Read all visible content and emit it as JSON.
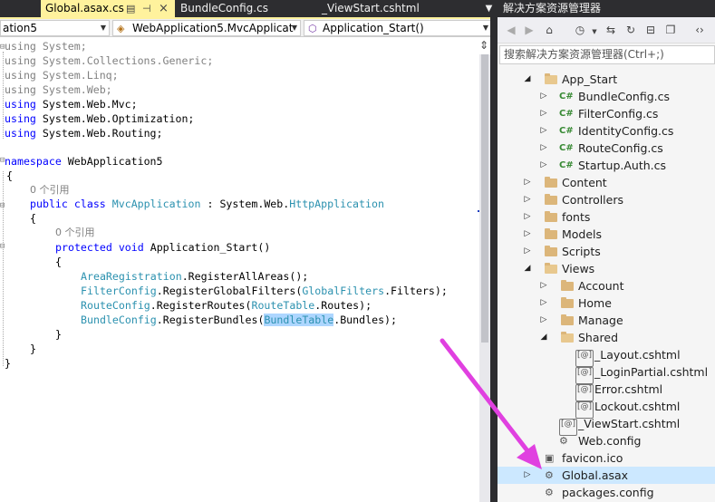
{
  "tabs": {
    "active": {
      "label": "Global.asax.cs",
      "pin_icon": "pin-icon",
      "close_icon": "close-icon"
    },
    "second": {
      "label": "BundleConfig.cs"
    },
    "third": {
      "label": "_ViewStart.cshtml"
    }
  },
  "nav": {
    "project": "ation5",
    "class": "WebApplication5.MvcApplicat",
    "member": "Application_Start()"
  },
  "code": {
    "using1": "using System;",
    "using2": "using System.Collections.Generic;",
    "using3": "using System.Linq;",
    "using4": "using System.Web;",
    "using5_kw": "using",
    "using5_ns": " System.Web.Mvc;",
    "using6_kw": "using",
    "using6_ns": " System.Web.Optimization;",
    "using7_kw": "using",
    "using7_ns": " System.Web.Routing;",
    "ns_kw": "namespace",
    "ns_name": " WebApplication5",
    "brace_open": "{",
    "brace_close": "}",
    "ref_class": "0 个引用",
    "class_kw1": "public",
    "class_kw2": "class",
    "class_name": "MvcApplication",
    "class_colon": " : ",
    "class_base_ns": "System.Web.",
    "class_base": "HttpApplication",
    "ref_method": "0 个引用",
    "method_kw1": "protected",
    "method_kw2": "void",
    "method_name": " Application_Start()",
    "l1_type": "AreaRegistration",
    "l1_rest": ".RegisterAllAreas();",
    "l2_type": "FilterConfig",
    "l2_mid": ".RegisterGlobalFilters(",
    "l2_type2": "GlobalFilters",
    "l2_rest": ".Filters);",
    "l3_type": "RouteConfig",
    "l3_mid": ".RegisterRoutes(",
    "l3_type2": "RouteTable",
    "l3_rest": ".Routes);",
    "l4_type": "BundleConfig",
    "l4_mid": ".RegisterBundles(",
    "l4_type2": "BundleTable",
    "l4_rest": ".Bundles);"
  },
  "explorer": {
    "title": "解决方案资源管理器",
    "search_placeholder": "搜索解决方案资源管理器(Ctrl+;)",
    "tree": [
      {
        "label": "App_Start"
      },
      {
        "label": "BundleConfig.cs",
        "badge": "C#"
      },
      {
        "label": "FilterConfig.cs",
        "badge": "C#"
      },
      {
        "label": "IdentityConfig.cs",
        "badge": "C#"
      },
      {
        "label": "RouteConfig.cs",
        "badge": "C#"
      },
      {
        "label": "Startup.Auth.cs",
        "badge": "C#"
      },
      {
        "label": "Content"
      },
      {
        "label": "Controllers"
      },
      {
        "label": "fonts"
      },
      {
        "label": "Models"
      },
      {
        "label": "Scripts"
      },
      {
        "label": "Views"
      },
      {
        "label": "Account"
      },
      {
        "label": "Home"
      },
      {
        "label": "Manage"
      },
      {
        "label": "Shared"
      },
      {
        "label": "_Layout.cshtml",
        "badge": "[@]"
      },
      {
        "label": "_LoginPartial.cshtml",
        "badge": "[@]"
      },
      {
        "label": "Error.cshtml",
        "badge": "[@]"
      },
      {
        "label": "Lockout.cshtml",
        "badge": "[@]"
      },
      {
        "label": "_ViewStart.cshtml",
        "badge": "[@]"
      },
      {
        "label": "Web.config"
      },
      {
        "label": "favicon.ico"
      },
      {
        "label": "Global.asax",
        "selected": true
      },
      {
        "label": "packages.config"
      }
    ]
  },
  "colors": {
    "keyword": "#0000ff",
    "type": "#2b91af",
    "annotation_arrow": "#e040e0",
    "selection": "#cce8ff"
  }
}
